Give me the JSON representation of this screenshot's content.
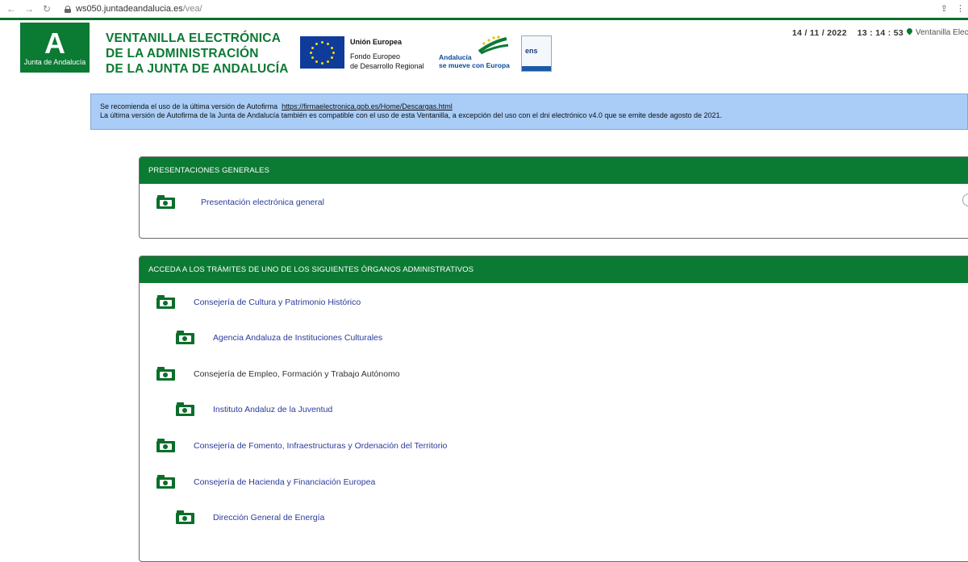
{
  "browser": {
    "url_host": "ws050.juntadeandalucia.es",
    "url_path": "/vea/"
  },
  "header": {
    "logo_letter": "A",
    "logo_text": "Junta de Andalucía",
    "title_line1": "VENTANILLA ELECTRÓNICA",
    "title_line2": "DE LA ADMINISTRACIÓN",
    "title_line3": "DE LA JUNTA DE ANDALUCÍA",
    "eu_title": "Unión Europea",
    "eu_line1": "Fondo Europeo",
    "eu_line2": "de Desarrollo Regional",
    "andalucia_line1": "Andalucía",
    "andalucia_line2": "se mueve con Europa",
    "ens_label": "ens",
    "date": "14 / 11 / 2022",
    "time": "13 : 14 : 53",
    "location": "Ventanilla Elec"
  },
  "notice": {
    "line1_prefix": "Se recomienda el uso de la última versión de Autofirma",
    "line1_link": "https://firmaelectronica.gob.es/Home/Descargas.html",
    "line2": "La última versión de Autofirma de la Junta de Andalucía también es compatible con el uso de esta Ventanilla, a excepción del uso con el dni electrónico v4.0 que se emite desde agosto de 2021."
  },
  "panel_general": {
    "title": "PRESENTACIONES GENERALES",
    "items": [
      {
        "label": "Presentación electrónica general"
      }
    ]
  },
  "panel_organos": {
    "title": "ACCEDA A LOS TRÁMITES DE UNO DE LOS SIGUIENTES ÓRGANOS ADMINISTRATIVOS",
    "items": [
      {
        "label": "Consejería de Cultura y Patrimonio Histórico"
      },
      {
        "label": "Agencia Andaluza de Instituciones Culturales"
      },
      {
        "label": "Consejería de Empleo, Formación y Trabajo Autónomo"
      },
      {
        "label": "Instituto Andaluz de la Juventud"
      },
      {
        "label": "Consejería de Fomento, Infraestructuras y Ordenación del Territorio"
      },
      {
        "label": "Consejería de Hacienda y Financiación Europea"
      },
      {
        "label": "Dirección General de Energía"
      }
    ]
  }
}
